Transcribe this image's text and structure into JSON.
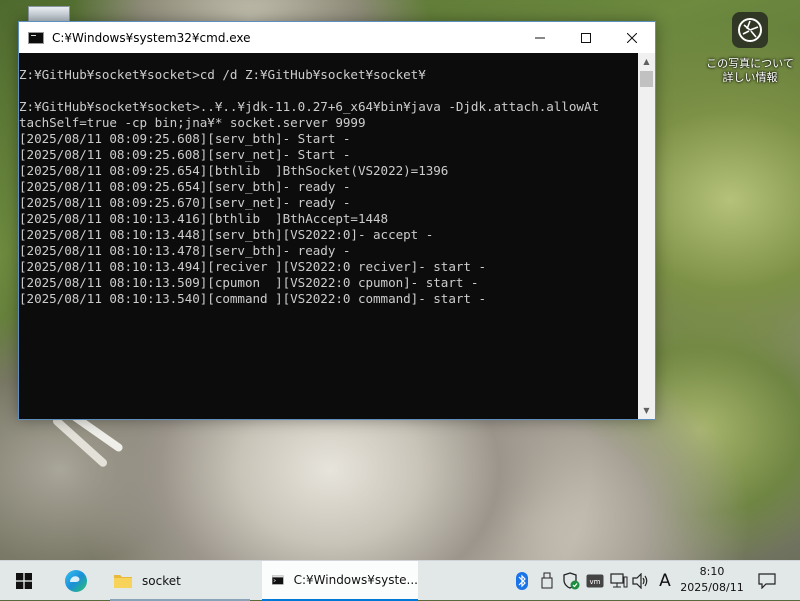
{
  "window": {
    "title": "C:¥Windows¥system32¥cmd.exe",
    "icon": "cmd-icon",
    "controls": [
      "minimize-icon",
      "maximize-icon",
      "close-icon"
    ]
  },
  "console": {
    "lines": [
      "Z:¥GitHub¥socket¥socket>cd /d Z:¥GitHub¥socket¥socket¥",
      "",
      "Z:¥GitHub¥socket¥socket>..¥..¥jdk-11.0.27+6_x64¥bin¥java -Djdk.attach.allowAt",
      "tachSelf=true -cp bin;jna¥* socket.server 9999",
      "[2025/08/11 08:09:25.608][serv_bth]- Start -",
      "[2025/08/11 08:09:25.608][serv_net]- Start -",
      "[2025/08/11 08:09:25.654][bthlib  ]BthSocket(VS2022)=1396",
      "[2025/08/11 08:09:25.654][serv_bth]- ready -",
      "[2025/08/11 08:09:25.670][serv_net]- ready -",
      "[2025/08/11 08:10:13.416][bthlib  ]BthAccept=1448",
      "[2025/08/11 08:10:13.448][serv_bth][VS2022:0]- accept -",
      "[2025/08/11 08:10:13.478][serv_bth]- ready -",
      "[2025/08/11 08:10:13.494][reciver ][VS2022:0 reciver]- start -",
      "[2025/08/11 08:10:13.509][cpumon  ][VS2022:0 cpumon]- start -",
      "[2025/08/11 08:10:13.540][command ][VS2022:0 command]- start -"
    ]
  },
  "desktop": {
    "photo_info_label_line1": "この写真について",
    "photo_info_label_line2": "詳しい情報",
    "photo_info_icon": "camera-lens-icon",
    "recycle_bin_icon": "recycle-bin-icon"
  },
  "taskbar": {
    "start_icon": "windows-logo-icon",
    "edge_icon": "edge-browser-icon",
    "tasks": [
      {
        "label": "socket",
        "icon": "folder-icon",
        "active": false
      },
      {
        "label": "C:¥Windows¥syste...",
        "icon": "cmd-icon",
        "active": true
      }
    ],
    "tray": {
      "icons": [
        "bluetooth-icon",
        "usb-device-icon",
        "security-shield-icon",
        "vm-icon",
        "network-icon",
        "volume-icon"
      ],
      "ime": "A",
      "time": "8:10",
      "date": "2025/08/11",
      "notification_icon": "notification-icon"
    }
  },
  "colors": {
    "console_bg": "#0c0c0c",
    "console_fg": "#cccccc",
    "accent": "#0078d7",
    "bluetooth": "#1a73e8"
  }
}
